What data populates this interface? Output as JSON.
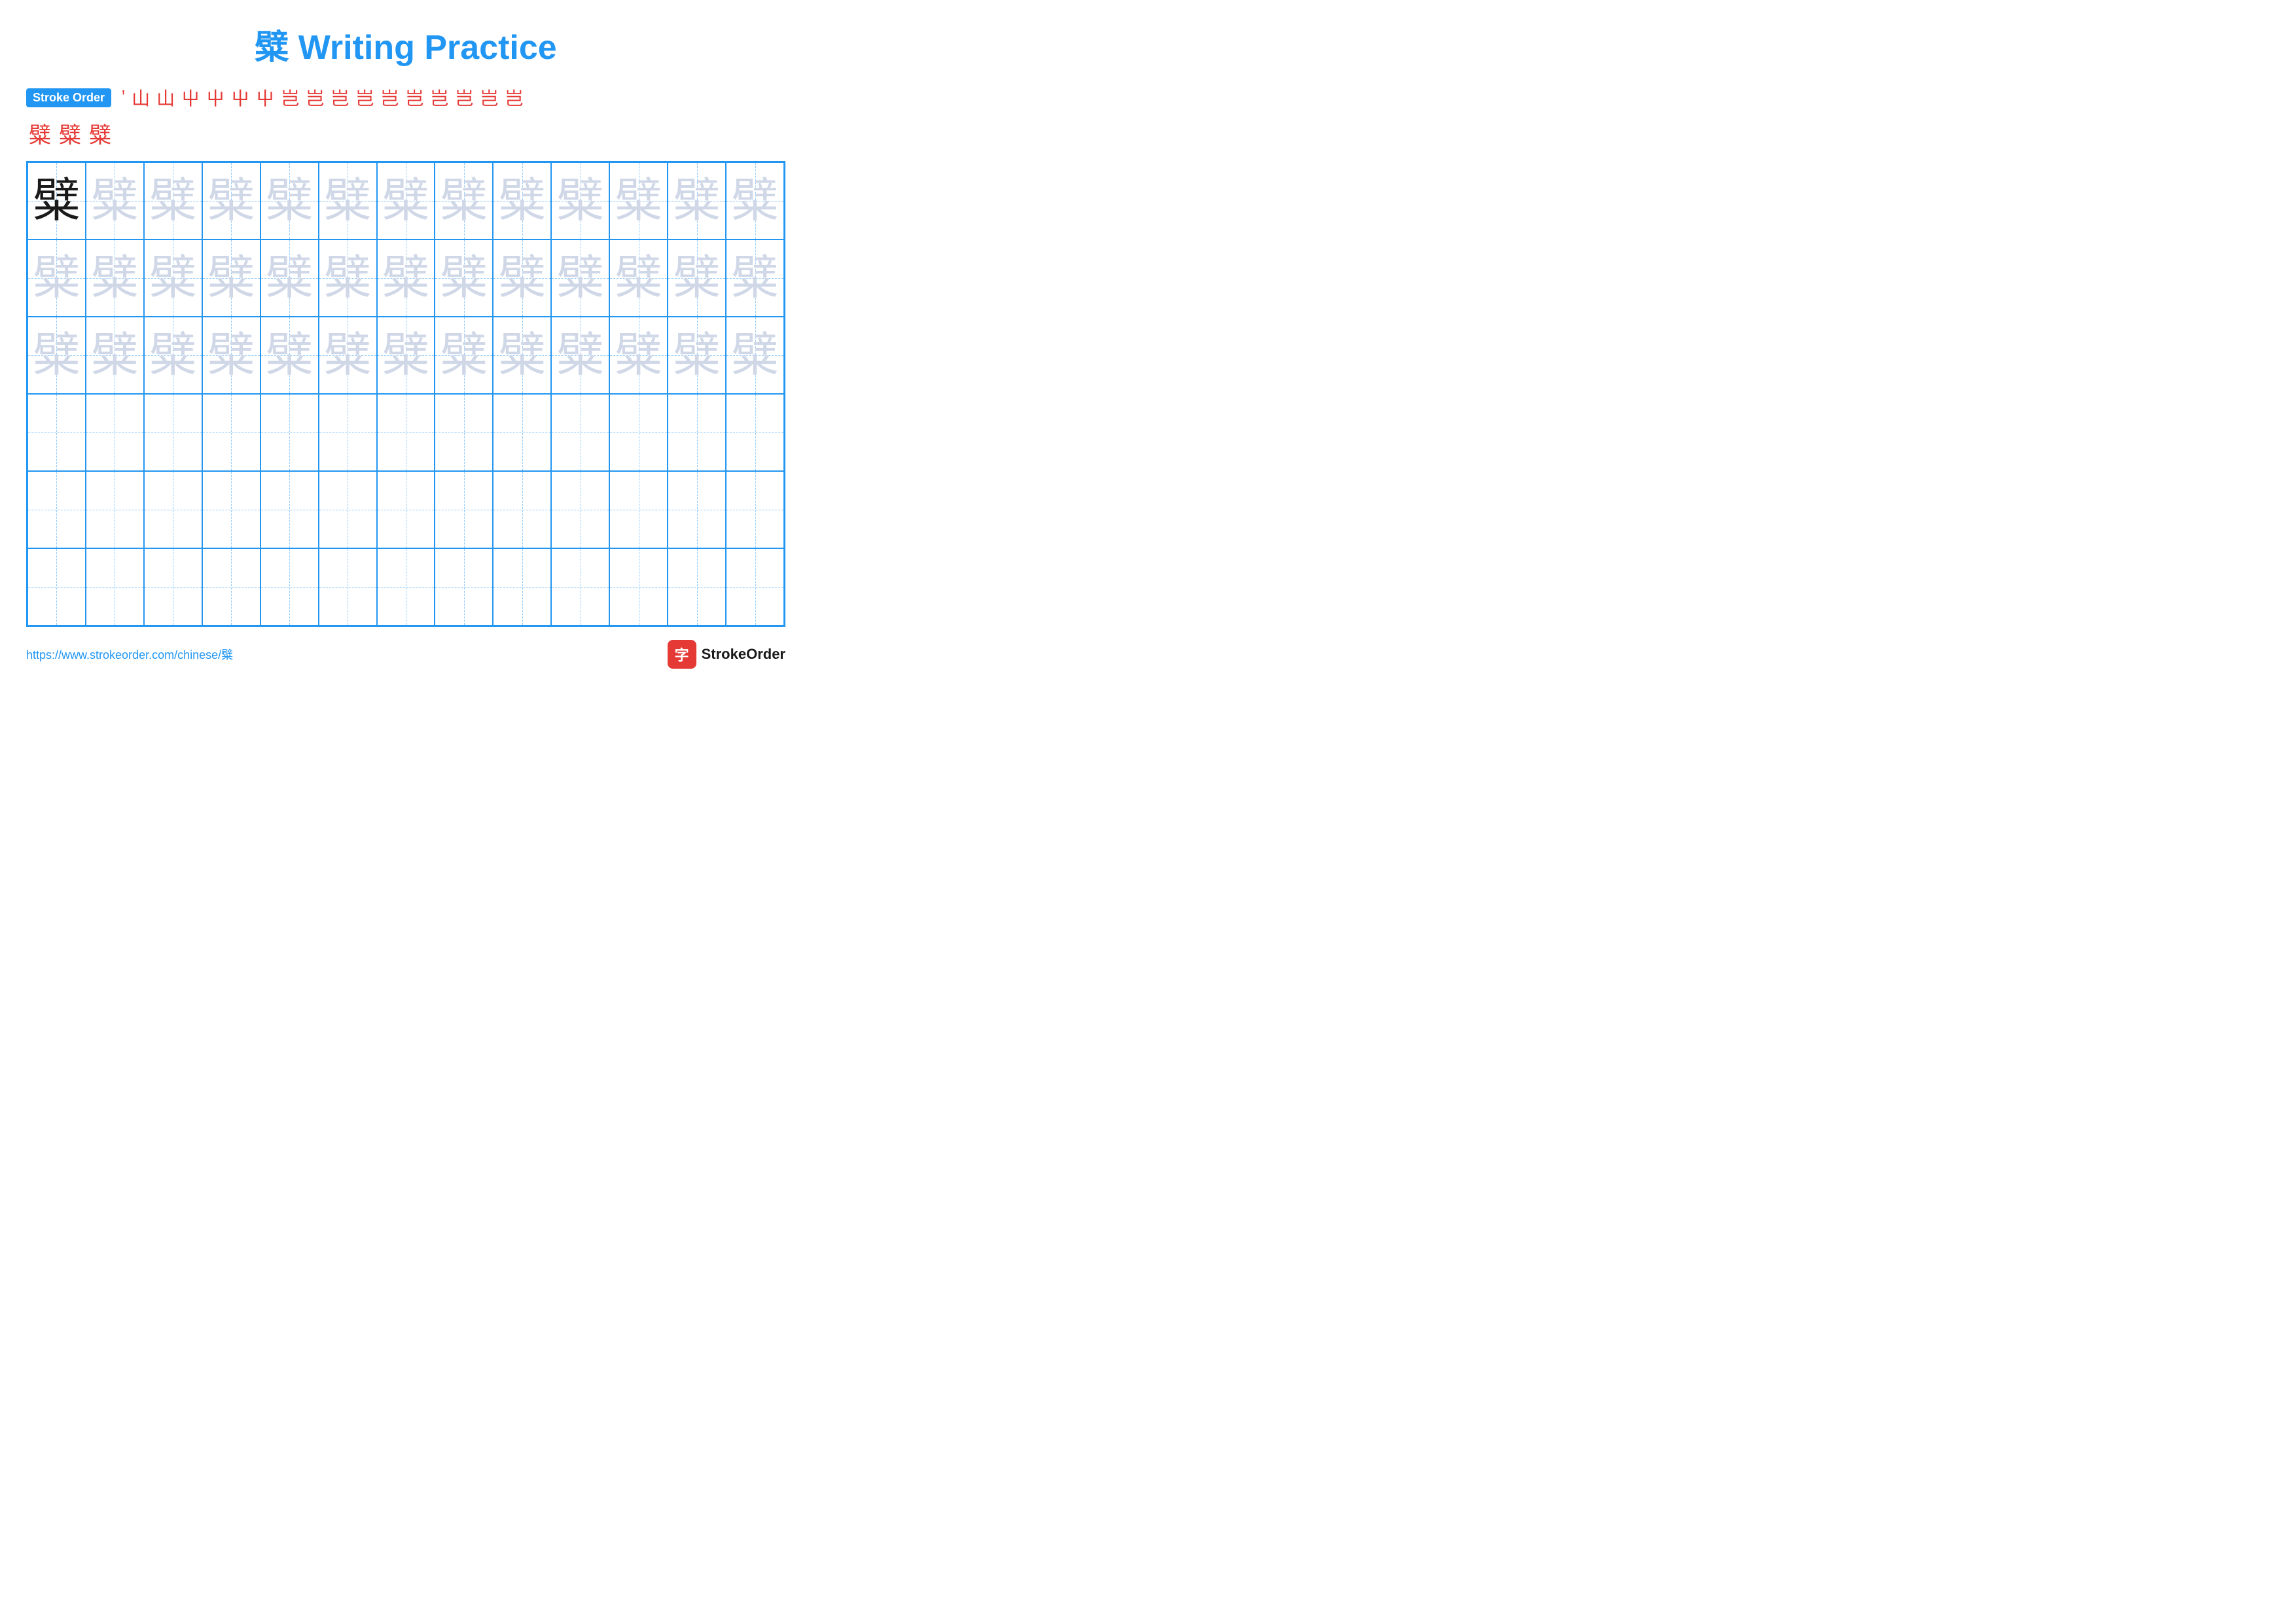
{
  "title": {
    "char": "糪",
    "text": " Writing Practice"
  },
  "stroke_order": {
    "badge_label": "Stroke Order",
    "strokes": [
      "'",
      "山",
      "山",
      "屮",
      "屮",
      "屮",
      "屮",
      "岂",
      "岂",
      "岂",
      "岂",
      "岂",
      "岂",
      "岂",
      "岂",
      "岂",
      "岂"
    ],
    "extra": [
      "糪",
      "糪",
      "糪"
    ]
  },
  "grid": {
    "rows": 6,
    "cols": 13,
    "character": "糪",
    "filled_rows": 3
  },
  "footer": {
    "url": "https://www.strokeorder.com/chinese/糪",
    "logo_char": "字",
    "logo_label": "StrokeOrder"
  }
}
